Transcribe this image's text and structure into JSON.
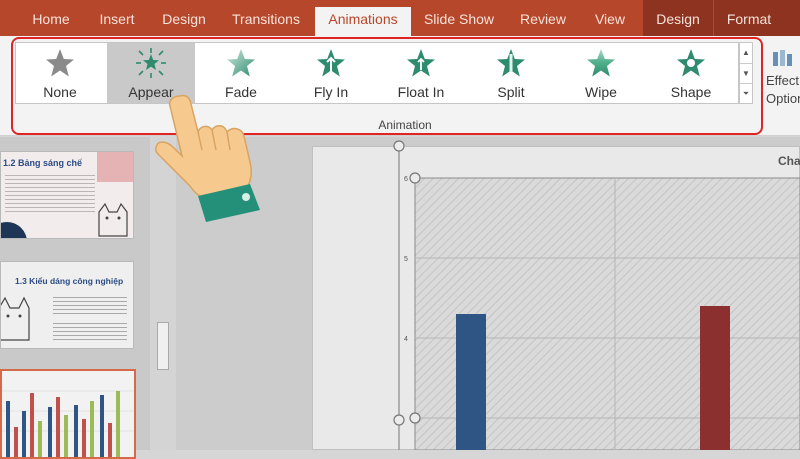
{
  "ribbon_tabs": [
    "Home",
    "Insert",
    "Design",
    "Transitions",
    "Animations",
    "Slide Show",
    "Review",
    "View",
    "Design",
    "Format"
  ],
  "gallery_items": [
    "None",
    "Appear",
    "Fade",
    "Fly In",
    "Float In",
    "Split",
    "Wipe",
    "Shape"
  ],
  "selected_gallery_item": "Appear",
  "group_label": "Animation",
  "effect_options_label": [
    "Effect",
    "Options"
  ],
  "thumbnails": {
    "slide1_title": "1.2 Bảng sáng chế",
    "slide2_title": "1.3 Kiểu dáng công nghiệp"
  },
  "chart": {
    "title_fragment": "Cha",
    "y_ticks": [
      "6",
      "5",
      "4"
    ]
  },
  "colors": {
    "accent": "#b7472a",
    "highlight": "#e02424",
    "star_green": "#2e8b6e",
    "bar_blue": "#2e5583",
    "bar_red": "#8b2f2f"
  }
}
